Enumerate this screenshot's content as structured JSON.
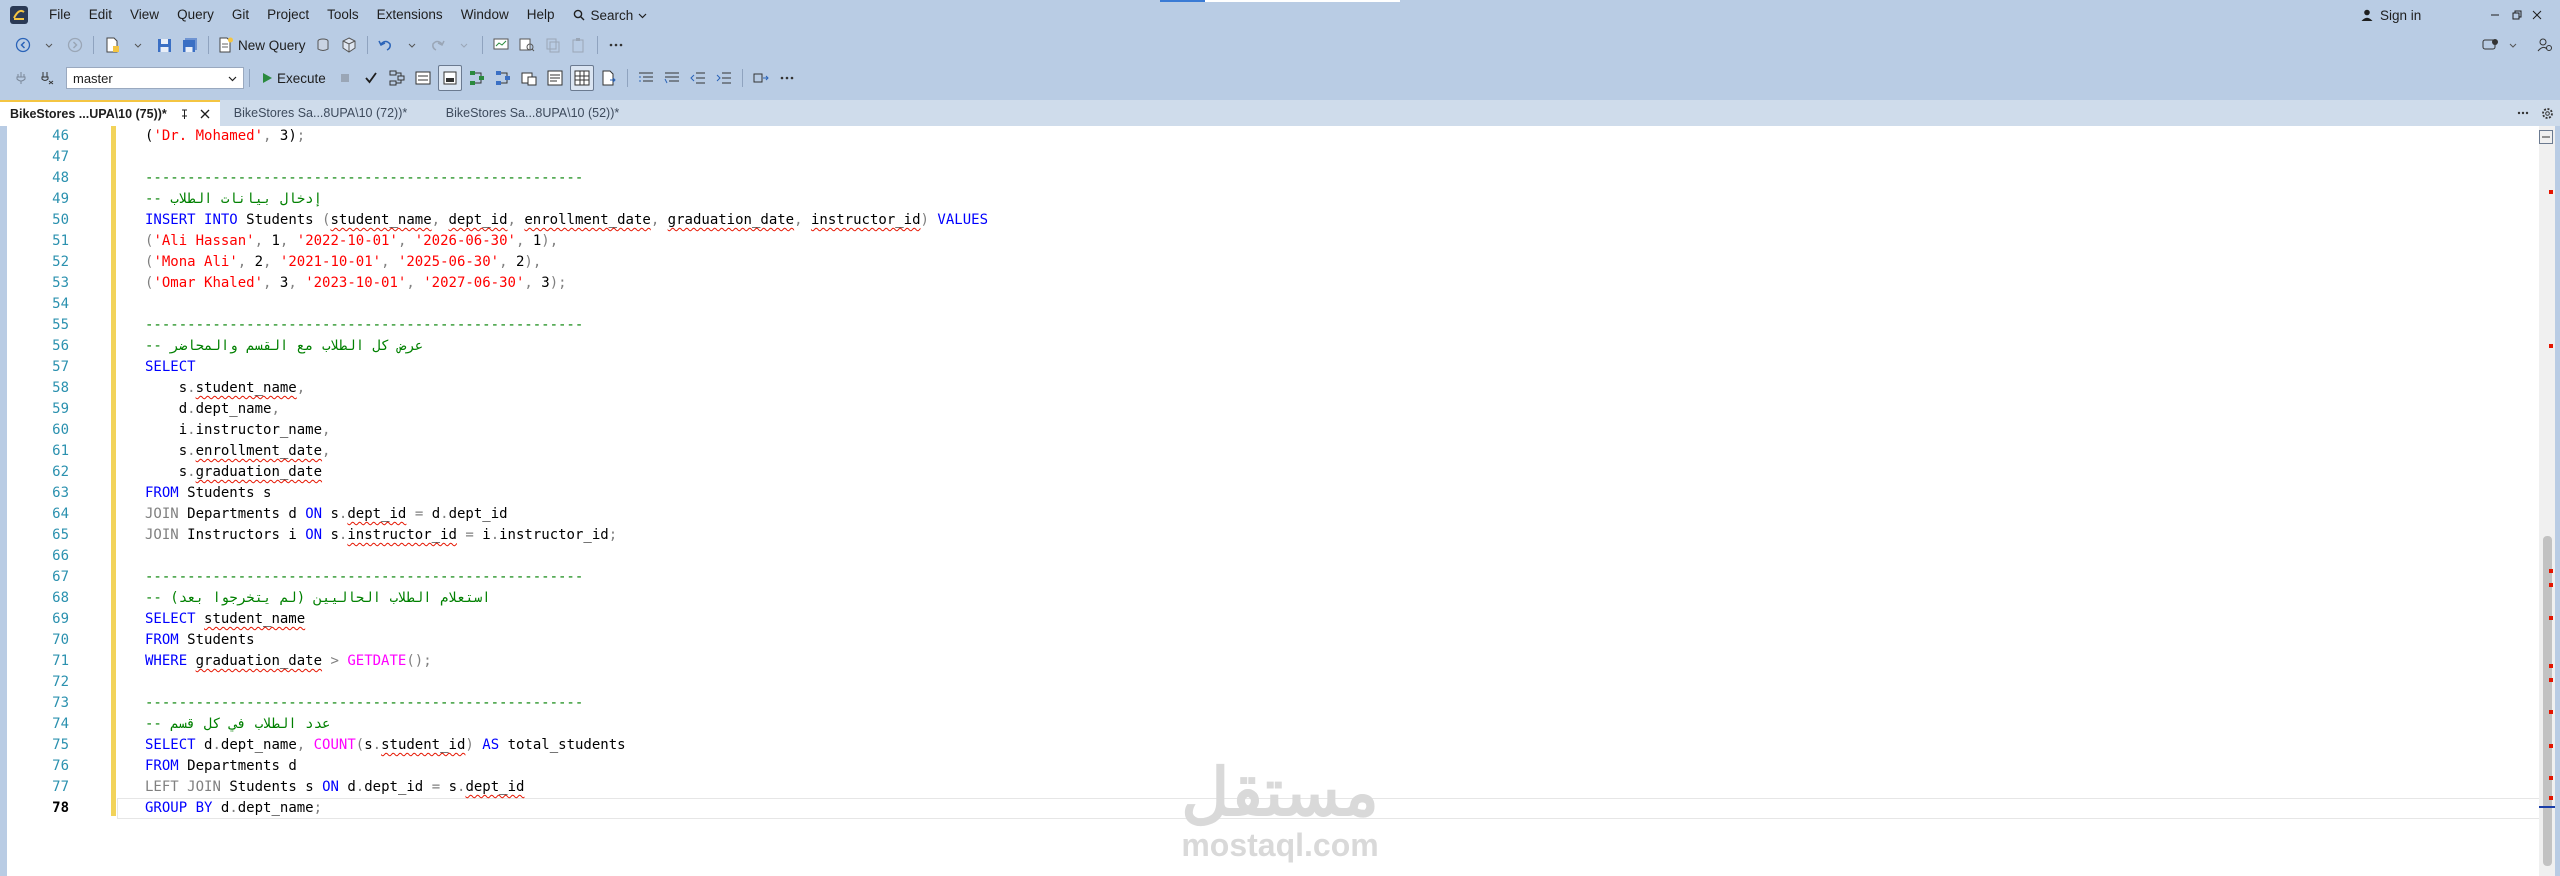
{
  "menu": [
    "File",
    "Edit",
    "View",
    "Query",
    "Git",
    "Project",
    "Tools",
    "Extensions",
    "Window",
    "Help"
  ],
  "search_label": "Search",
  "signin_label": "Sign in",
  "toolbar": {
    "new_query_label": "New Query",
    "execute_label": "Execute",
    "database": "master"
  },
  "tabs": [
    {
      "label": "BikeStores ...UPA\\10 (75))*",
      "active": true
    },
    {
      "label": "BikeStores Sa...8UPA\\10 (72))*",
      "active": false
    },
    {
      "label": "BikeStores Sa...8UPA\\10 (52))*",
      "active": false
    }
  ],
  "editor": {
    "line_numbers": [
      "46",
      "47",
      "48",
      "49",
      "50",
      "51",
      "52",
      "53",
      "54",
      "55",
      "56",
      "57",
      "58",
      "59",
      "60",
      "61",
      "62",
      "63",
      "64",
      "65",
      "66",
      "67",
      "68",
      "69",
      "70",
      "71",
      "72",
      "73",
      "74",
      "75",
      "76",
      "77",
      "78"
    ],
    "current_line": "78",
    "separator": "----------------------------------------------------",
    "t": {
      "lp": "(",
      "rp": ")",
      "sq": "'",
      "dr_mohamed": "Dr. Mohamed",
      "c_insert": "إدخال بيانات الطلاب",
      "c_select_all": "عرض كل الطلاب مع القسم والمحاضر",
      "c_current": "استعلام الطلاب الحاليين (لم يتخرجوا بعد)",
      "c_count": "عدد الطلاب في كل قسم",
      "INSERT": "INSERT",
      "INTO": "INTO",
      "VALUES": "VALUES",
      "SELECT": "SELECT",
      "FROM": "FROM",
      "JOIN": "JOIN",
      "ON": "ON",
      "WHERE": "WHERE",
      "AS": "AS",
      "LEFT": "LEFT",
      "GROUP_BY": "GROUP BY",
      "GETDATE": "GETDATE",
      "COUNT": "COUNT",
      "Students": "Students",
      "Departments": "Departments",
      "Instructors": "Instructors",
      "student_name": "student_name",
      "dept_id": "dept_id",
      "enrollment_date": "enrollment_date",
      "graduation_date": "graduation_date",
      "instructor_id": "instructor_id",
      "dept_name": "dept_name",
      "instructor_name": "instructor_name",
      "total_students": "total_students",
      "s": "s",
      "d": "d",
      "i": "i",
      "ali": "Ali Hassan",
      "mona": "Mona Ali",
      "omar": "Omar Khaled",
      "d1": "2022-10-01",
      "d2": "2026-06-30",
      "d3": "2021-10-01",
      "d4": "2025-06-30",
      "d5": "2023-10-01",
      "d6": "2027-06-30",
      "n1": "1",
      "n2": "2",
      "n3": "3"
    }
  },
  "watermark": {
    "logo": "مستقل",
    "url": "mostaql.com"
  },
  "colors": {
    "titlebar": "#b9cce4",
    "keyword": "#0000ff",
    "string": "#ff0000",
    "comment": "#008000",
    "function": "#ff00ff",
    "line_number": "#2b91af"
  }
}
